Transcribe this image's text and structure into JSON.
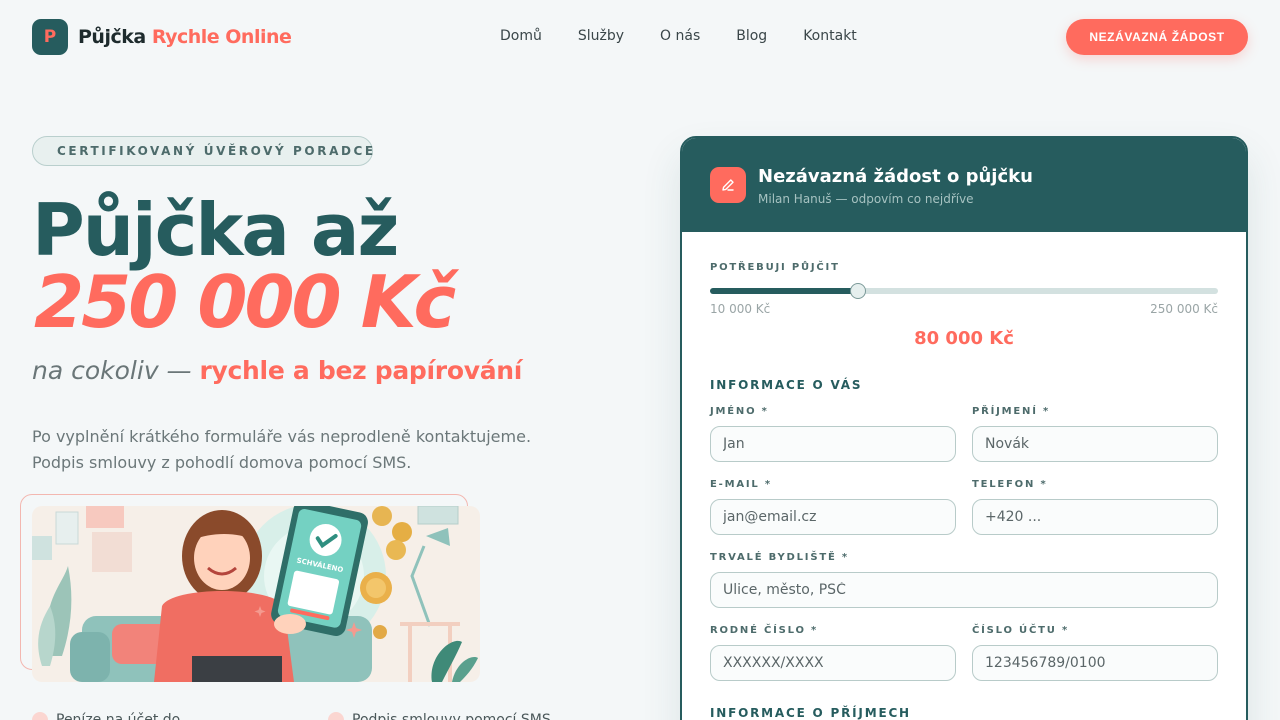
{
  "brand": {
    "mark": "P",
    "name": "Půjčka",
    "name_accent": "Rychle Online"
  },
  "nav": [
    "Domů",
    "Služby",
    "O nás",
    "Blog",
    "Kontakt"
  ],
  "header_cta": "NEZÁVAZNÁ ŽÁDOST",
  "hero": {
    "badge": "CERTIFIKOVANÝ ÚVĚROVÝ PORADCE",
    "title_line1": "Půjčka až",
    "title_line2": "250 000 Kč",
    "subtitle_part1": "na cokoliv —",
    "subtitle_part2": "rychle a bez papírování",
    "paragraph_line1": "Po vyplnění krátkého formuláře vás neprodleně kontaktujeme.",
    "paragraph_line2": "Podpis smlouvy z pohodlí domova pomocí SMS.",
    "illustration_stamp": "SCHVÁLENO",
    "features": [
      "Peníze na účet do...",
      "Podpis smlouvy pomocí SMS"
    ]
  },
  "form": {
    "title": "Nezávazná žádost o půjčku",
    "subtitle": "Milan Hanuš — odpovím co nejdříve",
    "amount_label": "POTŘEBUJI PŮJČIT",
    "amount_min": "10 000 Kč",
    "amount_max": "250 000 Kč",
    "amount_value": "80 000 Kč",
    "amount_fraction": 0.2917,
    "section_personal": "INFORMACE O VÁS",
    "fields": {
      "first_name": {
        "label": "JMÉNO *",
        "placeholder": "Jan"
      },
      "last_name": {
        "label": "PŘÍJMENÍ *",
        "placeholder": "Novák"
      },
      "email": {
        "label": "E-MAIL *",
        "placeholder": "jan@email.cz"
      },
      "phone": {
        "label": "TELEFON *",
        "placeholder": "+420 ..."
      },
      "address": {
        "label": "TRVALÉ BYDLIŠTĚ *",
        "placeholder": "Ulice, město, PSČ"
      },
      "birth_number": {
        "label": "RODNÉ ČÍSLO *",
        "placeholder": "XXXXXX/XXXX"
      },
      "account": {
        "label": "ČÍSLO ÚČTU *",
        "placeholder": "123456789/0100"
      }
    },
    "section_income": "INFORMACE O PŘÍJMECH"
  },
  "colors": {
    "primary": "#265c5e",
    "accent": "#ff6b5e",
    "background": "#f4f7f8"
  }
}
